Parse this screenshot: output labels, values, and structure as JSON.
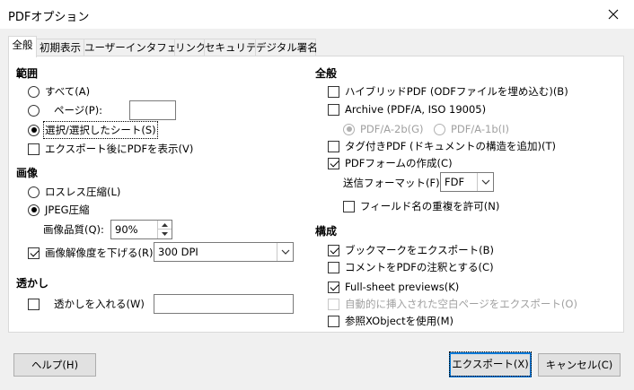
{
  "window": {
    "title": "PDFオプション"
  },
  "tabs": [
    {
      "label": "全般"
    },
    {
      "label": "初期表示"
    },
    {
      "label": "ユーザーインタフェース"
    },
    {
      "label": "リンク"
    },
    {
      "label": "セキュリティ"
    },
    {
      "label": "デジタル署名"
    }
  ],
  "range": {
    "heading": "範囲",
    "all": "すべて(A)",
    "pages": "ページ(P):",
    "pages_value": "",
    "selection": "選択/選択したシート(S)",
    "view_after": "エクスポート後にPDFを表示(V)"
  },
  "image": {
    "heading": "画像",
    "lossless": "ロスレス圧縮(L)",
    "jpeg": "JPEG圧縮",
    "quality_label": "画像品質(Q):",
    "quality_value": "90%",
    "reduce": "画像解像度を下げる(R)",
    "dpi_value": "300 DPI"
  },
  "watermark": {
    "heading": "透かし",
    "label": "透かしを入れる(W)",
    "value": ""
  },
  "general": {
    "heading": "全般",
    "hybrid": "ハイブリッドPDF (ODFファイルを埋め込む)(B)",
    "archive": "Archive (PDF/A, ISO 19005)",
    "pdfa2b": "PDF/A-2b(G)",
    "pdfa1b": "PDF/A-1b(I)",
    "tagged": "タグ付きPDF (ドキュメントの構造を追加)(T)",
    "form": "PDFフォームの作成(C)",
    "format_label": "送信フォーマット(F):",
    "format_value": "FDF",
    "dup_names": "フィールド名の重複を許可(N)"
  },
  "structure": {
    "heading": "構成",
    "bookmarks": "ブックマークをエクスポート(B)",
    "comments": "コメントをPDFの注釈とする(C)",
    "fullsheet": "Full-sheet previews(K)",
    "blank_pages": "自動的に挿入された空白ページをエクスポート(O)",
    "xobject": "参照XObjectを使用(M)"
  },
  "buttons": {
    "help": "ヘルプ(H)",
    "export": "エクスポート(X)",
    "cancel": "キャンセル(C)"
  }
}
